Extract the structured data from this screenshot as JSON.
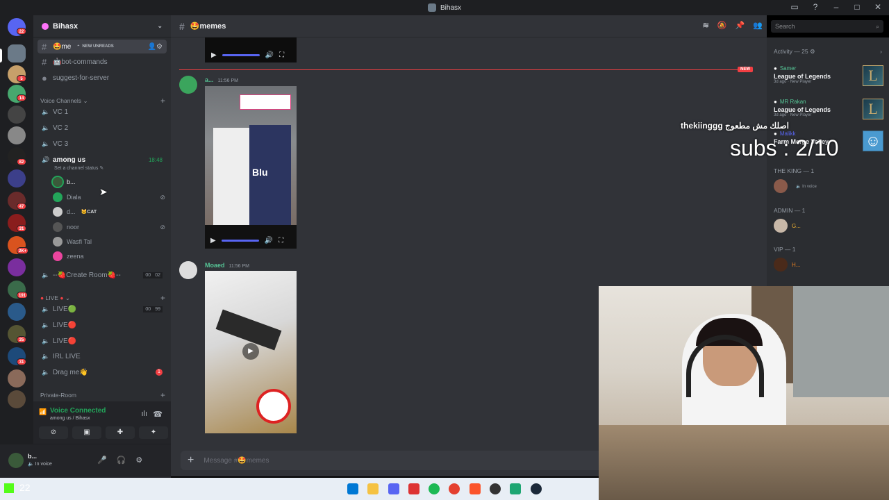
{
  "window": {
    "title": "Bihasx"
  },
  "server": {
    "name": "Bihasx"
  },
  "guild_badges": [
    "22",
    "5",
    "14",
    "82",
    "47",
    "31",
    "2K+",
    "191",
    "25",
    "31"
  ],
  "text_channels": [
    {
      "name": "🤩me",
      "unread_label": "NEW UNREADS"
    },
    {
      "name": "🤖bot-commands"
    },
    {
      "name": "suggest-for-server"
    }
  ],
  "voice_category": "Voice Channels",
  "voice_channels": [
    "VC 1",
    "VC 2",
    "VC 3"
  ],
  "among_us": {
    "name": "among us",
    "time": "18:48",
    "status": "Set a channel status",
    "users": [
      {
        "name": "b..."
      },
      {
        "name": "Diala"
      },
      {
        "name": "d...",
        "tag": "🐱CAT"
      },
      {
        "name": "noor"
      },
      {
        "name": "Wasfi Tal"
      },
      {
        "name": "zeena"
      }
    ]
  },
  "create_room": {
    "name": "--🍓Create Room🍓--",
    "count_a": "00",
    "count_b": "02"
  },
  "live_category": "LIVE",
  "live_channels": [
    {
      "name": "LIVE🟢",
      "count_a": "00",
      "count_b": "99"
    },
    {
      "name": "LIVE🔴"
    },
    {
      "name": "LIVE🔴"
    },
    {
      "name": "IRL LIVE"
    },
    {
      "name": "Drag me👋",
      "badge": "1"
    }
  ],
  "private_category": "Private-Room",
  "voice_panel": {
    "title": "Voice Connected",
    "subtitle": "among us / Bihasx"
  },
  "user_panel": {
    "name": "b...",
    "status": "In voice"
  },
  "main": {
    "channel": "🤩memes",
    "new_label": "NEW",
    "messages": [
      {
        "author": "a...",
        "time": "11:56 PM"
      },
      {
        "author": "Moaed",
        "time": "11:56 PM"
      }
    ],
    "image_caption": "Blu",
    "composer_placeholder": "Message #🤩memes"
  },
  "search": {
    "placeholder": "Search"
  },
  "activity": {
    "header": "Activity — 25",
    "cards": [
      {
        "name": "Samer",
        "game": "League of Legends",
        "meta": "3d ago",
        "tag": "New Player"
      },
      {
        "name": "MR Rakan",
        "game": "League of Legends",
        "meta": "3d ago",
        "tag": "New Player"
      },
      {
        "name": "Malikk",
        "game": "Farm Merge Valley"
      }
    ],
    "roles": [
      {
        "role": "THE KING — 1",
        "member": "",
        "status": "In voice"
      },
      {
        "role": "ADMIN — 1",
        "member": "G..."
      },
      {
        "role": "VIP — 1",
        "member": "H..."
      }
    ]
  },
  "overlay": {
    "subs": "subs : 2/10",
    "arabic": "thekiinggg اصلك مش مطعوج"
  },
  "taskbar": {
    "temp": "22"
  },
  "colors": {
    "accent": "#5865f2",
    "online": "#23a55a",
    "danger": "#f23f43",
    "bg": "#313338"
  }
}
